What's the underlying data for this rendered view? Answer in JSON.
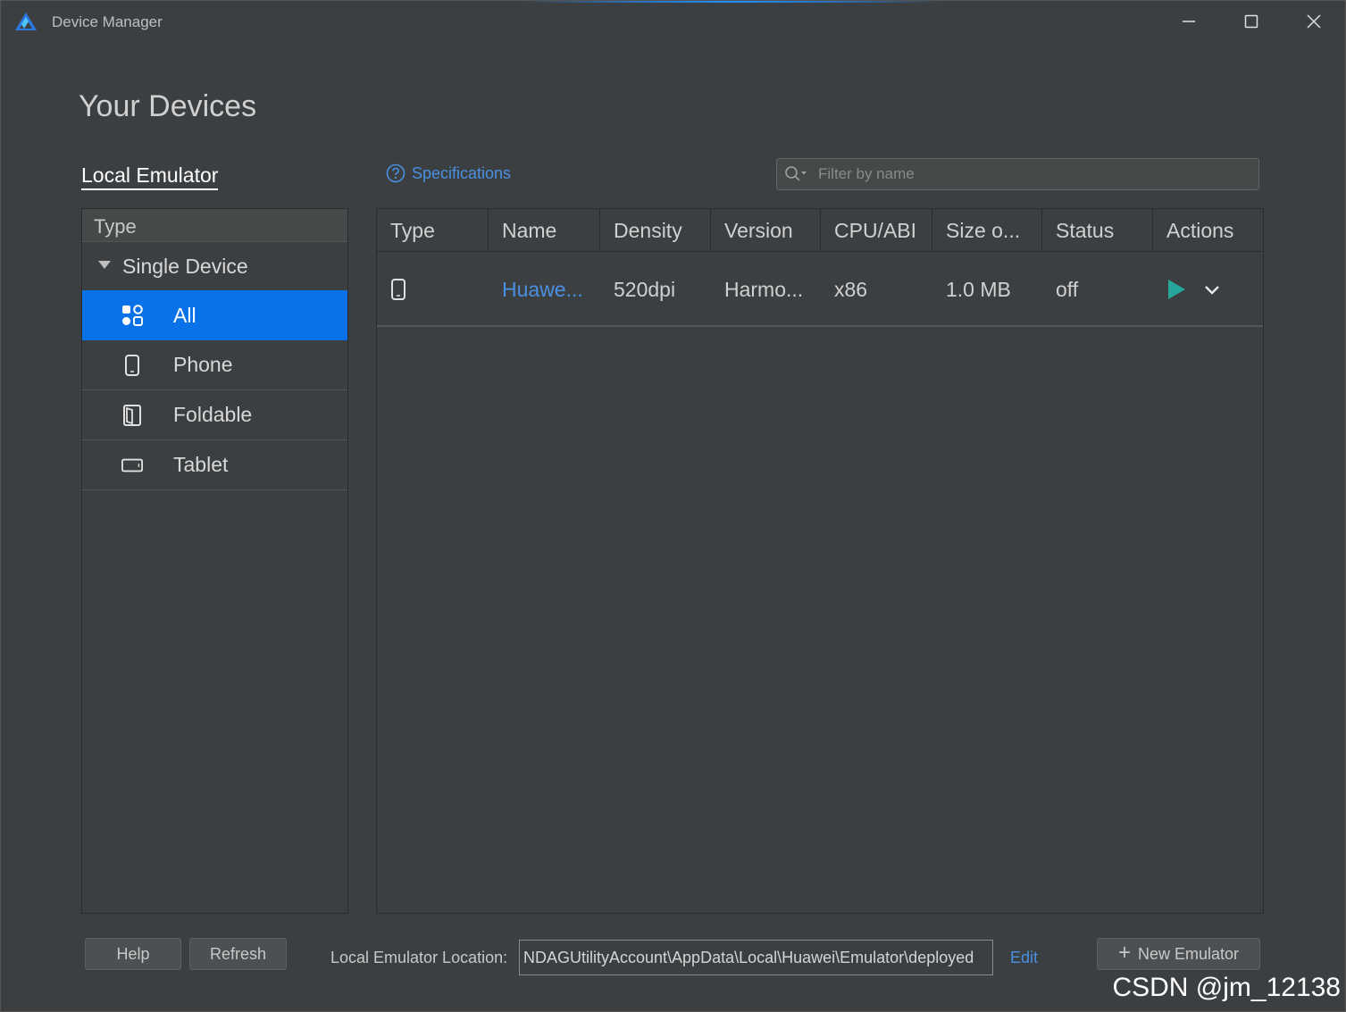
{
  "window": {
    "title": "Device Manager",
    "minimize_icon": "minimize-icon",
    "maximize_icon": "maximize-icon",
    "close_icon": "close-icon"
  },
  "page_title": "Your Devices",
  "tabs": {
    "local_emulator": "Local Emulator"
  },
  "specifications_link": "Specifications",
  "search": {
    "placeholder": "Filter by name",
    "value": ""
  },
  "sidebar": {
    "header": "Type",
    "group": "Single Device",
    "items": [
      {
        "label": "All",
        "icon": "grid-icon",
        "selected": true
      },
      {
        "label": "Phone",
        "icon": "phone-icon",
        "selected": false
      },
      {
        "label": "Foldable",
        "icon": "foldable-icon",
        "selected": false
      },
      {
        "label": "Tablet",
        "icon": "tablet-icon",
        "selected": false
      }
    ]
  },
  "table": {
    "columns": [
      "Type",
      "Name",
      "Density",
      "Version",
      "CPU/ABI",
      "Size o...",
      "Status",
      "Actions"
    ],
    "rows": [
      {
        "type_icon": "phone-icon",
        "name": "Huawe...",
        "density": "520dpi",
        "version": "Harmo...",
        "cpu": "x86",
        "size": "1.0 MB",
        "status": "off"
      }
    ]
  },
  "footer": {
    "help": "Help",
    "refresh": "Refresh",
    "location_label": "Local Emulator Location:",
    "location_value": "NDAGUtilityAccount\\AppData\\Local\\Huawei\\Emulator\\deployed",
    "edit": "Edit",
    "new_emulator": "New Emulator"
  },
  "watermark": "CSDN @jm_12138",
  "colors": {
    "accent": "#0a72e8",
    "link": "#4a90e2",
    "play": "#26a69a",
    "background": "#3c3f41"
  }
}
